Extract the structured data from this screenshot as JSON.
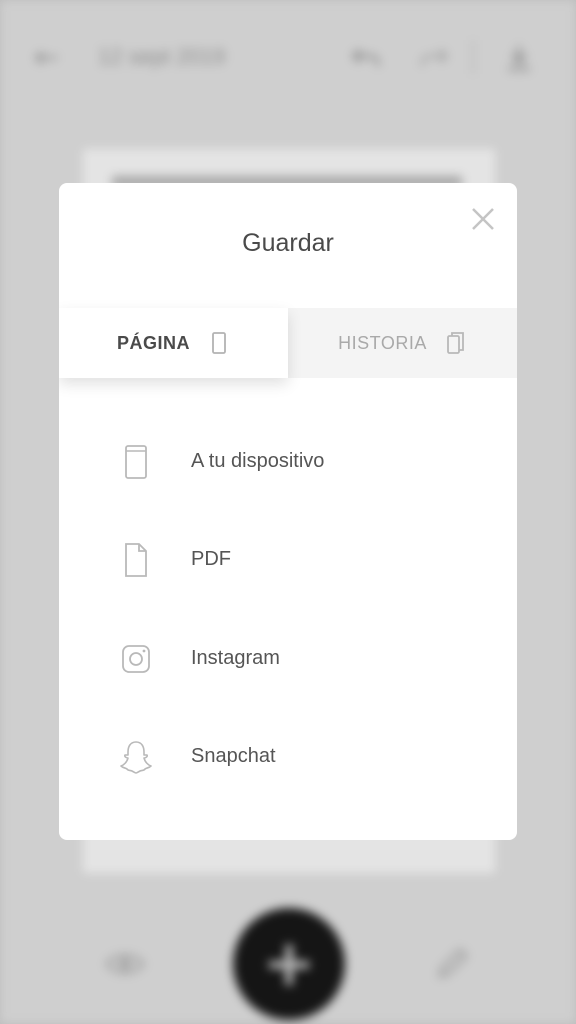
{
  "background": {
    "date": "12 sept 2019",
    "icons": [
      "back-arrow-icon",
      "undo-icon",
      "redo-icon",
      "download-icon",
      "eye-icon",
      "plus-icon",
      "pencil-icon"
    ]
  },
  "modal": {
    "title": "Guardar",
    "close_icon": "close-icon",
    "tabs": [
      {
        "label": "PÁGINA",
        "icon": "single-page-icon",
        "active": true
      },
      {
        "label": "HISTORIA",
        "icon": "stacked-pages-icon",
        "active": false
      }
    ],
    "options": [
      {
        "label": "A tu dispositivo",
        "icon": "phone-icon"
      },
      {
        "label": "PDF",
        "icon": "document-icon"
      },
      {
        "label": "Instagram",
        "icon": "instagram-icon"
      },
      {
        "label": "Snapchat",
        "icon": "snapchat-ghost-icon"
      }
    ]
  },
  "colors": {
    "overlay": "#bdbdbd",
    "modal_bg": "#ffffff",
    "text_primary": "#4a4a4a",
    "text_muted": "#a9a9a9",
    "fab": "#151515"
  }
}
